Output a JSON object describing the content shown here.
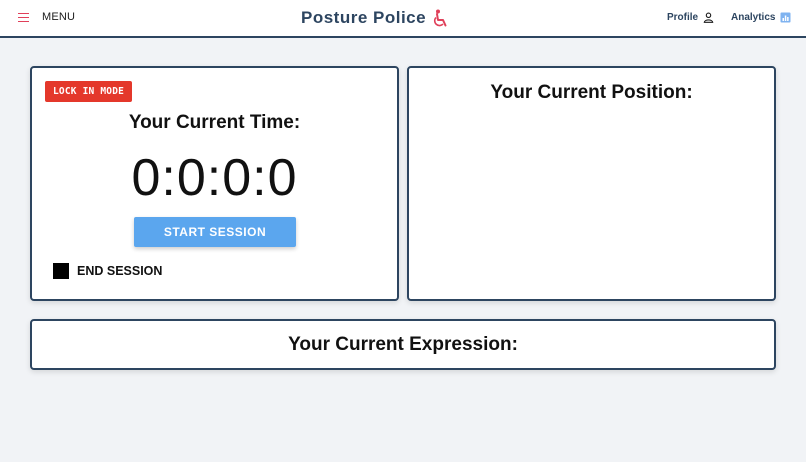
{
  "header": {
    "menu_label": "MENU",
    "brand_title": "Posture Police",
    "brand_icon": "wheelchair-icon",
    "profile_label": "Profile",
    "analytics_label": "Analytics"
  },
  "timer_panel": {
    "mode_badge": "LOCK IN MODE",
    "heading": "Your Current Time:",
    "time": "0:0:0:0",
    "start_button": "START SESSION",
    "end_label": "END SESSION"
  },
  "position_panel": {
    "heading": "Your Current Position:"
  },
  "expression_panel": {
    "heading": "Your Current Expression:"
  },
  "colors": {
    "accent": "#2d4560",
    "badge": "#e4382b",
    "button": "#5ba6ee",
    "icon": "#e0405a"
  }
}
